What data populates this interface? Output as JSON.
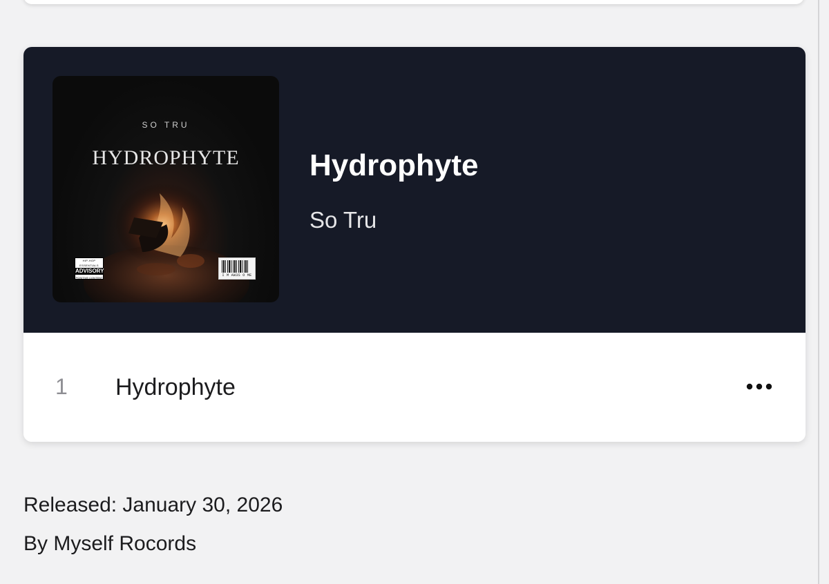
{
  "album": {
    "title": "Hydrophyte",
    "artist": "So Tru",
    "header_color": "#161a27"
  },
  "cover_art": {
    "artist_text": "SO TRU",
    "title_text": "HYDROPHYTE",
    "advisory": {
      "line1": "HIP-HOP ESSENTIALS",
      "line2": "ADVISORY",
      "line3": "POSITIVE CONTENT"
    },
    "barcode_text": "I M  AW3S O ME"
  },
  "tracks": [
    {
      "number": "1",
      "title": "Hydrophyte",
      "more_icon": "more-horizontal-icon"
    }
  ],
  "release": {
    "released_text": "Released: January 30, 2026",
    "label_text": "By Myself Rocords"
  }
}
